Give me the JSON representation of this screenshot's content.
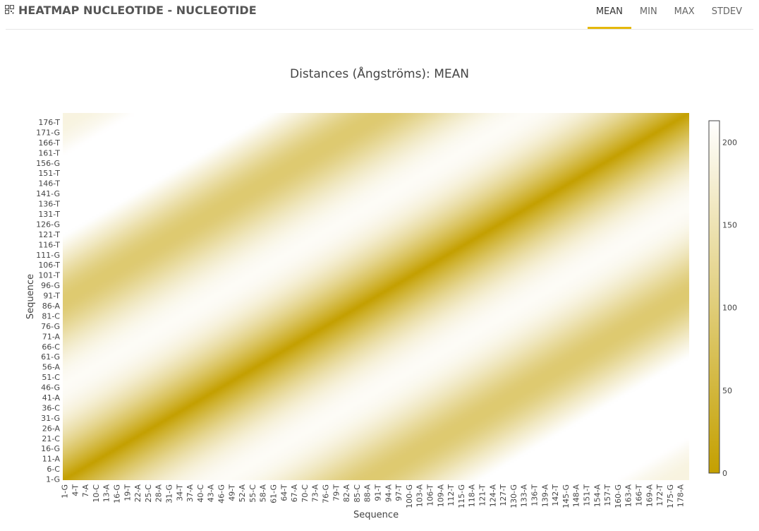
{
  "header": {
    "title": "HEATMAP NUCLEOTIDE - NUCLEOTIDE",
    "logo_icon": "grid-icon",
    "tabs": [
      {
        "label": "MEAN",
        "active": true
      },
      {
        "label": "MIN",
        "active": false
      },
      {
        "label": "MAX",
        "active": false
      },
      {
        "label": "STDEV",
        "active": false
      }
    ],
    "accent_color": "#e5b80b"
  },
  "chart_data": {
    "type": "heatmap",
    "title": "Distances (Ångströms): MEAN",
    "xlabel": "Sequence",
    "ylabel": "Sequence",
    "x_ticks": [
      "1-G",
      "4-T",
      "7-A",
      "10-C",
      "13-A",
      "16-G",
      "19-T",
      "22-A",
      "25-C",
      "28-A",
      "31-G",
      "34-T",
      "37-A",
      "40-C",
      "43-A",
      "46-G",
      "49-T",
      "52-A",
      "55-C",
      "58-A",
      "61-G",
      "64-T",
      "67-A",
      "70-C",
      "73-A",
      "76-G",
      "79-T",
      "82-A",
      "85-C",
      "88-A",
      "91-T",
      "94-A",
      "97-T",
      "100-G",
      "103-A",
      "106-T",
      "109-A",
      "112-T",
      "115-G",
      "118-A",
      "121-T",
      "124-A",
      "127-T",
      "130-G",
      "133-A",
      "136-T",
      "139-A",
      "142-T",
      "145-G",
      "148-A",
      "151-T",
      "154-A",
      "157-T",
      "160-G",
      "163-A",
      "166-T",
      "169-A",
      "172-T",
      "175-G",
      "178-A"
    ],
    "y_ticks": [
      "1-G",
      "6-C",
      "11-A",
      "16-G",
      "21-C",
      "26-A",
      "31-G",
      "36-C",
      "41-A",
      "46-G",
      "51-C",
      "56-A",
      "61-G",
      "66-C",
      "71-A",
      "76-G",
      "81-C",
      "86-A",
      "91-T",
      "96-G",
      "101-T",
      "106-T",
      "111-G",
      "116-T",
      "121-T",
      "126-G",
      "131-T",
      "136-T",
      "141-G",
      "146-T",
      "151-T",
      "156-G",
      "161-T",
      "166-T",
      "171-G",
      "176-T"
    ],
    "n": 180,
    "zmin": 0,
    "zmax": 213,
    "colorbar_ticks": [
      0,
      50,
      100,
      150,
      200
    ],
    "colorscale": [
      "#c4a000",
      "#ffffff"
    ]
  }
}
